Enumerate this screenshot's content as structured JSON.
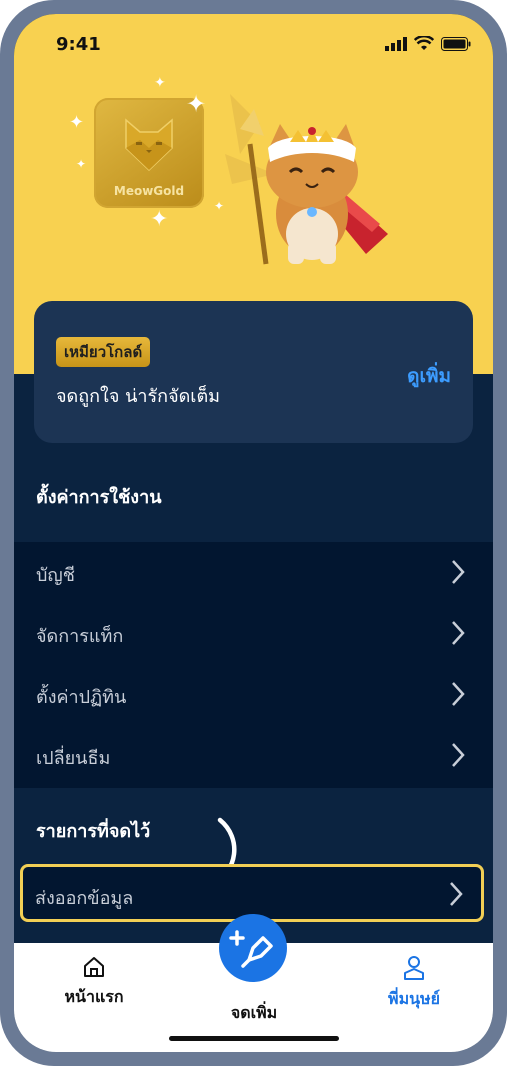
{
  "status_bar": {
    "time": "9:41"
  },
  "hero": {
    "badge_label": "MeowGold"
  },
  "promo": {
    "pill": "เหมียวโกลด์",
    "description": "จดถูกใจ น่ารักจัดเต็ม",
    "more_link": "ดูเพิ่ม"
  },
  "settings": {
    "title": "ตั้งค่าการใช้งาน",
    "items": [
      {
        "label": "บัญชี"
      },
      {
        "label": "จัดการแท็ก"
      },
      {
        "label": "ตั้งค่าปฏิทิน"
      },
      {
        "label": "เปลี่ยนธีม"
      }
    ]
  },
  "saved": {
    "title": "รายการที่จดไว้",
    "export_label": "ส่งออกข้อมูล"
  },
  "tabbar": {
    "home": "หน้าแรก",
    "add": "จดเพิ่ม",
    "friends": "พี่มนุษย์"
  },
  "colors": {
    "accent_blue": "#1b74e4",
    "hero_yellow": "#f8d150",
    "dark_navy": "#0b2340",
    "highlight_yellow": "#f2cf55"
  }
}
